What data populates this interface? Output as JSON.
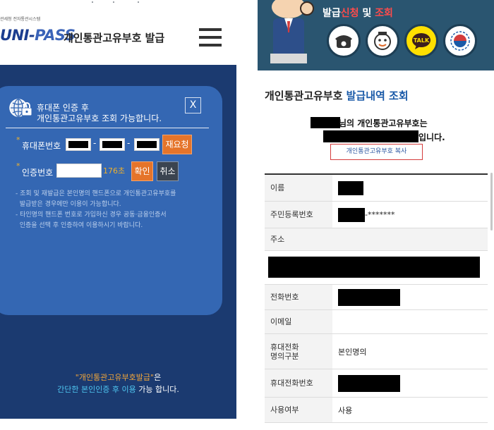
{
  "left": {
    "logo_small": "관세청 전자통관시스템",
    "logo_uni": "UNI-",
    "logo_pass": "PASS",
    "title": "개인통관고유부호 발급",
    "auth_panel": {
      "header_line1": "휴대폰 인증 후",
      "header_line2": "개인통관고유부호 조회 가능합니다.",
      "close_label": "X",
      "phone_label": "휴대폰번호",
      "dash": "-",
      "resend_label": "재요청",
      "code_label": "인증번호",
      "timer": "176초",
      "confirm_label": "확인",
      "cancel_label": "취소",
      "notes": [
        "- 조회 및 재발급은 본인명의 핸드폰으로 개인통관고유부호를",
        "  발급받은 경우에만 이용이 가능합니다.",
        "- 타인명의 핸드폰 번호로 가입하신 경우 공동·금융인증서",
        "  인증을 선택 후 인증하여 이용하시기 바랍니다."
      ]
    },
    "promo": {
      "line1_highlight": "\"개인통관고유부호발급\"",
      "line1_suffix": "은",
      "line2_highlight": "간단한 본인인증 후 이용",
      "line2_suffix": " 가능 합니다."
    }
  },
  "right": {
    "banner": {
      "title_prefix": "발급",
      "title_accent": "신청",
      "title_mid": " 및 ",
      "title_accent2": "조회",
      "icons": [
        "phone-icon",
        "mascot-icon",
        "kakao-talk-icon",
        "government-emblem-icon"
      ],
      "talk_label": "TALK"
    },
    "heading_prefix": "개인통관고유부호 ",
    "heading_highlight": "발급내역 조회",
    "result_line1": "님의 개인통관고유부호는",
    "result_line2": "입니다.",
    "copy_button": "개인통관고유부호 복사",
    "table": {
      "name_label": "이름",
      "rrn_label": "주민등록번호",
      "rrn_masked": "-*******",
      "address_label": "주소",
      "phone_label": "전화번호",
      "email_label": "이메일",
      "mobile_owner_label": "휴대전화\n명의구분",
      "mobile_owner_value": "본인명의",
      "mobile_label": "휴대전화번호",
      "use_label": "사용여부",
      "use_value": "사용"
    }
  },
  "colors": {
    "left_background": "#1b3a70",
    "panel": "#3467b3",
    "orange_button": "#e5742a",
    "accent_yellow": "#f0b12a",
    "link_blue": "#1a5aa8",
    "copy_border": "#d43c3c"
  }
}
